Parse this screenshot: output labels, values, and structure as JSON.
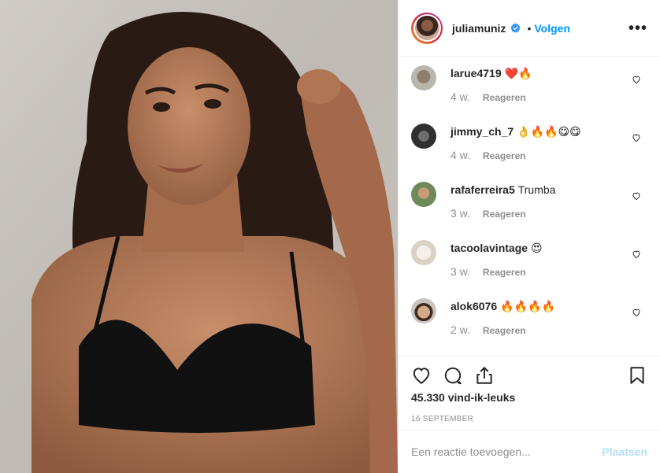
{
  "header": {
    "username": "juliamuniz",
    "dot": "•",
    "follow_label": "Volgen",
    "more_label": "•••"
  },
  "comments": [
    {
      "user": "larue4719",
      "text": "❤️🔥",
      "time": "4 w.",
      "reply": "Reageren",
      "avatar_color": "#b8b6ad"
    },
    {
      "user": "jimmy_ch_7",
      "text": "👌🔥🔥😋😋",
      "time": "4 w.",
      "reply": "Reageren",
      "avatar_color": "#3a3a3a"
    },
    {
      "user": "rafaferreira5",
      "text": "Trumba",
      "time": "3 w.",
      "reply": "Reageren",
      "avatar_color": "#6f8a5a"
    },
    {
      "user": "tacoolavintage",
      "text": "😍",
      "time": "3 w.",
      "reply": "Reageren",
      "avatar_color": "#e2dcd0"
    },
    {
      "user": "alok6076",
      "text": "🔥🔥🔥🔥",
      "time": "2 w.",
      "reply": "Reageren",
      "avatar_color": "#b7906f"
    }
  ],
  "post": {
    "likes": "45.330 vind-ik-leuks",
    "date": "16 SEPTEMBER"
  },
  "add_comment": {
    "placeholder": "Een reactie toevoegen...",
    "post_label": "Plaatsen"
  },
  "colors": {
    "accent": "#0095f6",
    "post_disabled": "#b2dffc",
    "muted": "#8e8e8e"
  },
  "icons": [
    "more-icon",
    "verified-icon",
    "heart-icon",
    "comment-icon",
    "share-icon",
    "save-icon"
  ]
}
